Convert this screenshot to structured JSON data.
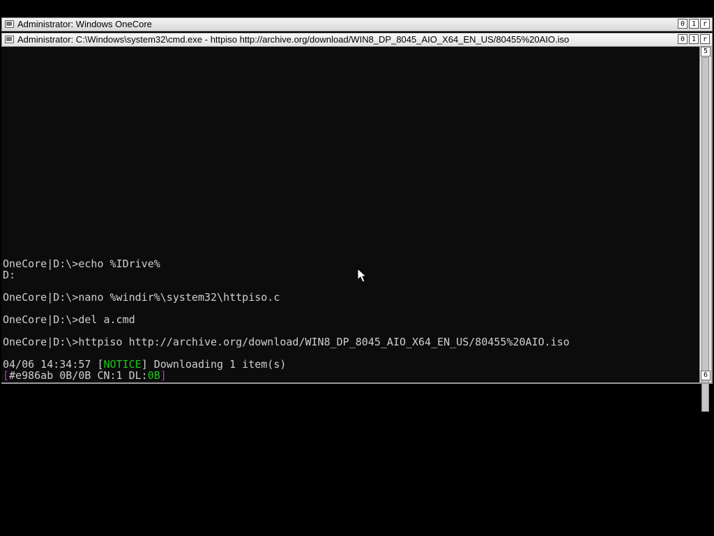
{
  "outer_window": {
    "title": "Administrator:  Windows OneCore",
    "buttons": [
      "0",
      "1",
      "r"
    ]
  },
  "inner_window": {
    "title": "Administrator: C:\\Windows\\system32\\cmd.exe - httpiso  http://archive.org/download/WIN8_DP_8045_AIO_X64_EN_US/80455%20AIO.iso",
    "buttons": [
      "0",
      "1",
      "r"
    ]
  },
  "scrollbar": {
    "up_label": "5",
    "down_label": "6"
  },
  "console": {
    "lines": [
      "OneCore|D:\\>echo %IDrive%",
      "D:",
      "OneCore|D:\\>nano %windir%\\system32\\httpiso.c",
      "OneCore|D:\\>del a.cmd",
      "OneCore|D:\\>httpiso http://archive.org/download/WIN8_DP_8045_AIO_X64_EN_US/80455%20AIO.iso"
    ],
    "notice": {
      "timestamp": "04/06 14:34:57",
      "bracket_open": "[",
      "tag": "NOTICE",
      "bracket_close": "]",
      "message": "Downloading 1 item(s)"
    },
    "progress": {
      "open": "[",
      "body": "#e986ab 0B/0B CN:1 DL:",
      "dl_value": "0B",
      "close": "]"
    }
  },
  "colors": {
    "notice": "#18c818",
    "progress_bracket": "#c02fc0",
    "text": "#cfcfcf"
  },
  "cursor_icon": "mouse-pointer-icon"
}
